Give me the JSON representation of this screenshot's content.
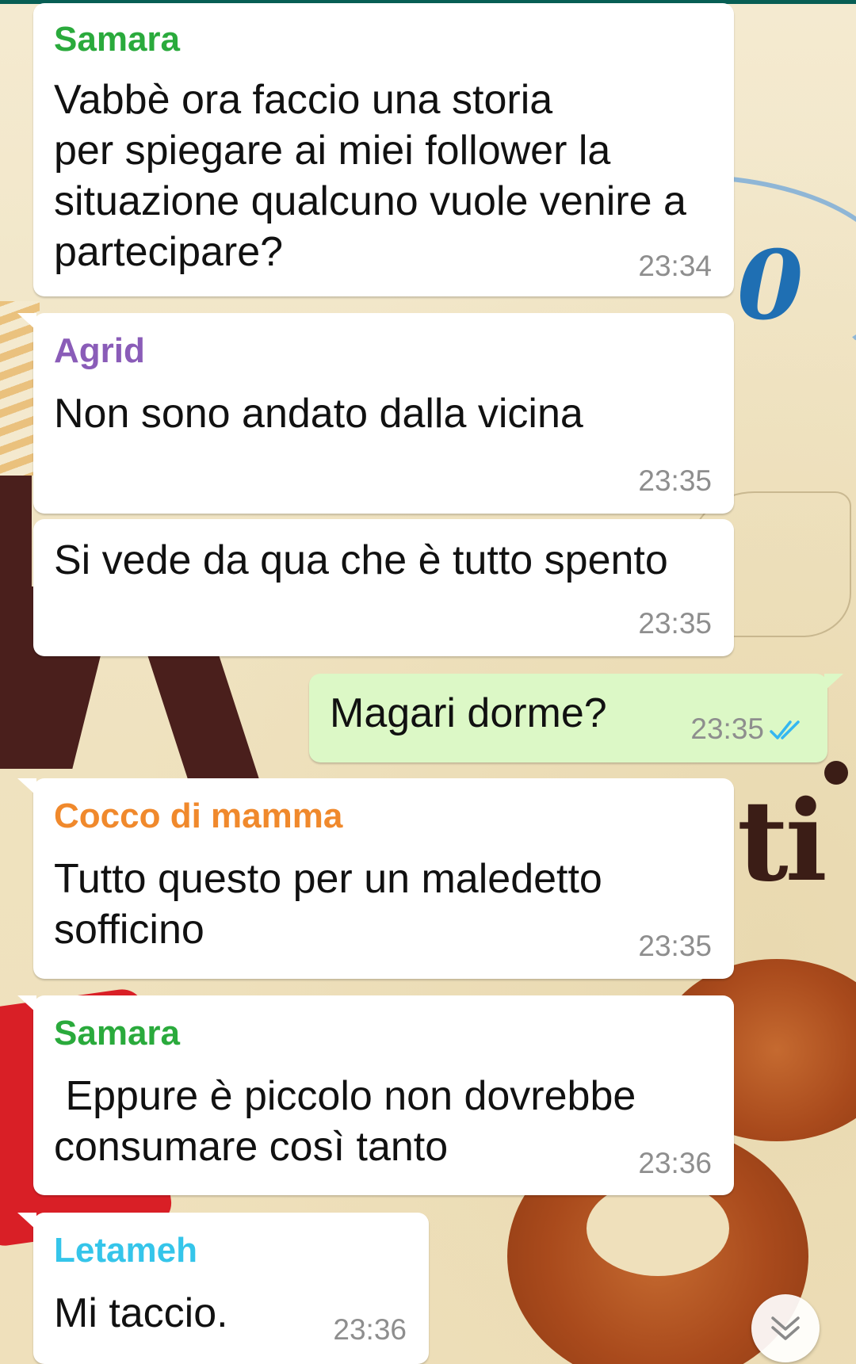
{
  "colors": {
    "incoming_bubble": "#ffffff",
    "outgoing_bubble": "#dcf8c6",
    "timestamp": "#8e8e8e",
    "read_ticks": "#34b7f1",
    "top_bar": "#075e54"
  },
  "messages": [
    {
      "sender": "Samara",
      "sender_color": "#2aaa3c",
      "text": "Vabbè ora faccio una storia\nper spiegare ai miei follower la\nsituazione qualcuno vuole venire a\npartecipare?",
      "time": "23:34"
    },
    {
      "sender": "Agrid",
      "sender_color": "#8a5cb8",
      "text": "Non sono andato dalla vicina",
      "time": "23:35"
    },
    {
      "text": "Si vede da qua che è tutto spento",
      "time": "23:35"
    },
    {
      "text": "Magari dorme?",
      "time": "23:35",
      "status_icon": "double-check-icon"
    },
    {
      "sender": "Cocco di mamma",
      "sender_color": "#f0892c",
      "text": "Tutto questo per un maledetto\nsofficino",
      "time": "23:35"
    },
    {
      "sender": "Samara",
      "sender_color": "#2aaa3c",
      "text": " Eppure è piccolo non dovrebbe\nconsumare così tanto",
      "time": "23:36"
    },
    {
      "sender": "Letameh",
      "sender_color": "#35c5ea",
      "text": "Mi taccio.",
      "time": "23:36"
    }
  ],
  "scroll_button": {
    "icon": "double-chevron-down-icon"
  }
}
